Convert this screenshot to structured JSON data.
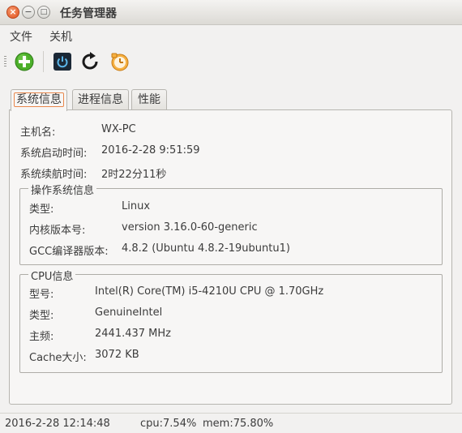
{
  "window": {
    "title": "任务管理器",
    "close_glyph": "×",
    "minimize_glyph": "−",
    "maximize_glyph": "□"
  },
  "menu": [
    "文件",
    "关机"
  ],
  "toolbar": {
    "icons": [
      "add-icon",
      "power-icon",
      "refresh-icon",
      "shutdown-timer-icon"
    ]
  },
  "tabs": [
    {
      "label": "系统信息",
      "active": true
    },
    {
      "label": "进程信息",
      "active": false
    },
    {
      "label": "性能",
      "active": false
    }
  ],
  "system": {
    "host_label": "主机名:",
    "host_value": "WX-PC",
    "boot_label": "系统启动时间:",
    "boot_value": "2016-2-28 9:51:59",
    "uptime_label": "系统续航时间:",
    "uptime_value": "2时22分11秒"
  },
  "os": {
    "title": "操作系统信息",
    "rows": [
      {
        "label": "类型:",
        "value": "Linux"
      },
      {
        "label": "内核版本号:",
        "value": "version 3.16.0-60-generic"
      },
      {
        "label": "GCC编译器版本:",
        "value": "4.8.2 (Ubuntu 4.8.2-19ubuntu1)"
      }
    ]
  },
  "cpu": {
    "title": "CPU信息",
    "rows": [
      {
        "label": "型号:",
        "value": "Intel(R) Core(TM) i5-4210U CPU @ 1.70GHz"
      },
      {
        "label": "类型:",
        "value": "GenuineIntel"
      },
      {
        "label": "主频:",
        "value": "2441.437 MHz"
      },
      {
        "label": "Cache大小:",
        "value": "3072 KB"
      }
    ]
  },
  "status": {
    "time": "2016-2-28 12:14:48",
    "cpu": "cpu:7.54%",
    "mem": "mem:75.80%"
  },
  "colors": {
    "accent_orange": "#e2511d",
    "add_green": "#4caf2a",
    "tab_focus": "#e9874c"
  }
}
